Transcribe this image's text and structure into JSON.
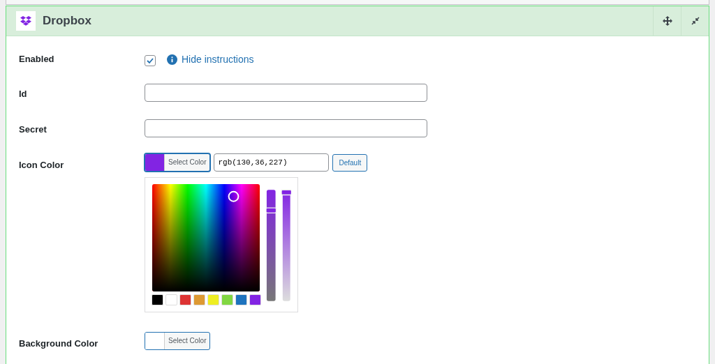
{
  "panel": {
    "title": "Dropbox"
  },
  "fields": [
    {
      "kind": "checkbox",
      "label": "Enabled",
      "checked": true,
      "link": "Hide instructions"
    },
    {
      "kind": "text",
      "label": "Id"
    },
    {
      "kind": "text",
      "label": "Secret"
    },
    {
      "kind": "color",
      "label": "Icon Color",
      "button": "Select Color",
      "color": "#8224e3",
      "value": "rgb(130,36,227)",
      "reset": "Default",
      "expanded": true,
      "hue_slider": {
        "level": 0.83
      },
      "opacity_slider": {
        "level": 1
      },
      "palette": [
        {
          "color": "#000000"
        },
        {
          "color": "#ffffff"
        },
        {
          "color": "#dd3333"
        },
        {
          "color": "#dd9933"
        },
        {
          "color": "#eeee22"
        },
        {
          "color": "#81d742"
        },
        {
          "color": "#1e73be"
        },
        {
          "color": "#8224e3"
        }
      ]
    },
    {
      "kind": "color",
      "label": "Background Color",
      "button": "Select Color",
      "color": "#ffffff",
      "expanded": false
    }
  ]
}
